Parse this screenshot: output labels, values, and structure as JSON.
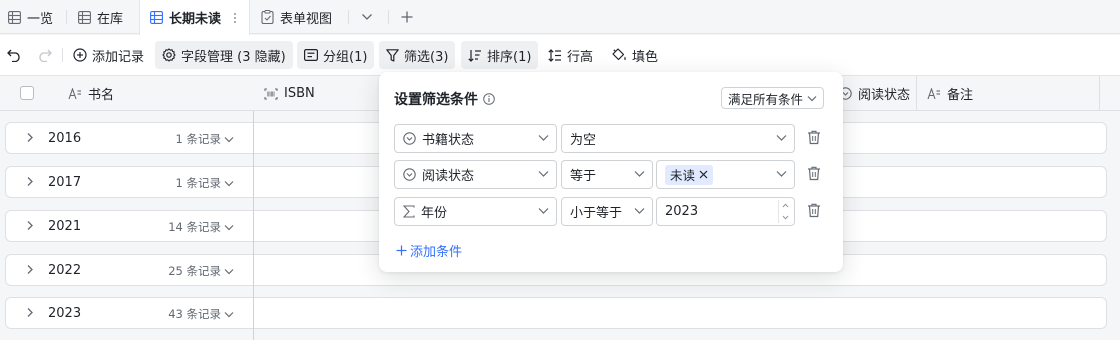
{
  "tabs": [
    {
      "label": "一览",
      "icon": "grid-table-icon"
    },
    {
      "label": "在库",
      "icon": "grid-table-icon"
    },
    {
      "label": "长期未读",
      "icon": "grid-table-icon",
      "active": true
    },
    {
      "label": "表单视图",
      "icon": "form-icon"
    }
  ],
  "toolbar": {
    "add_record": "添加记录",
    "field_manage": "字段管理 (3 隐藏)",
    "group": "分组(1)",
    "filter": "筛选(3)",
    "sort": "排序(1)",
    "row_height": "行高",
    "fill": "填色"
  },
  "columns": {
    "book_name": "书名",
    "isbn": "ISBN",
    "read_status": "阅读状态",
    "notes": "备注"
  },
  "groups": [
    {
      "name": "2016",
      "count": "1 条记录"
    },
    {
      "name": "2017",
      "count": "1 条记录"
    },
    {
      "name": "2021",
      "count": "14 条记录"
    },
    {
      "name": "2022",
      "count": "25 条记录"
    },
    {
      "name": "2023",
      "count": "43 条记录"
    }
  ],
  "filter_panel": {
    "title": "设置筛选条件",
    "match_mode": "满足所有条件",
    "conditions": [
      {
        "field": "书籍状态",
        "field_icon": "single-select-icon",
        "operator": "为空",
        "value": ""
      },
      {
        "field": "阅读状态",
        "field_icon": "single-select-icon",
        "operator": "等于",
        "value_tag": "未读"
      },
      {
        "field": "年份",
        "field_icon": "sum-icon",
        "operator": "小于等于",
        "value": "2023"
      }
    ],
    "add_condition": "添加条件"
  },
  "colors": {
    "accent": "#3370ff",
    "tag_bg": "#e1eaff",
    "border": "#dee0e3"
  }
}
